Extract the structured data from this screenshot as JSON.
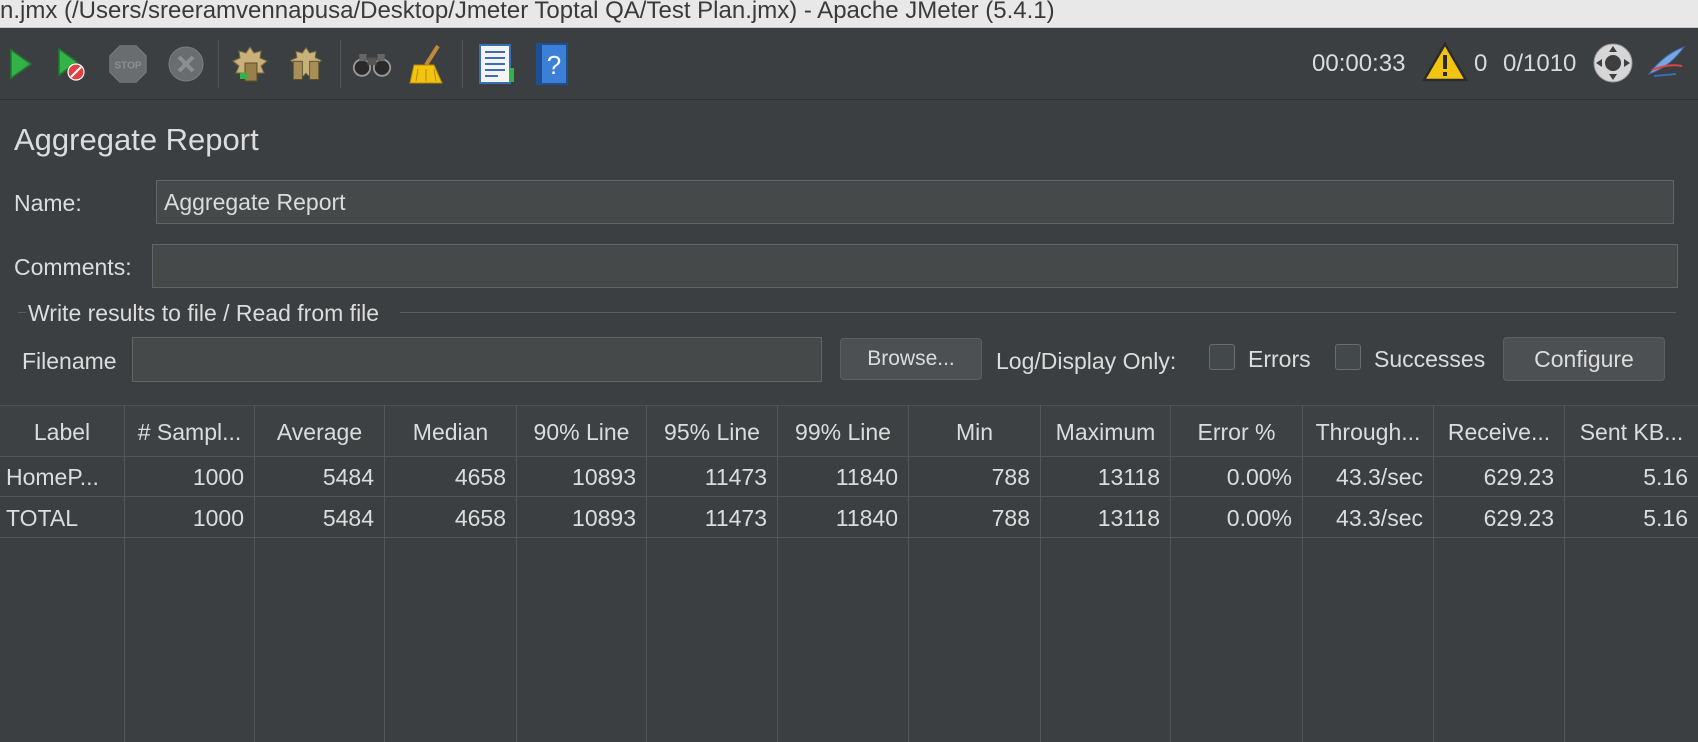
{
  "window": {
    "title": "n.jmx (/Users/sreeramvennapusa/Desktop/Jmeter Toptal QA/Test Plan.jmx) - Apache JMeter (5.4.1)"
  },
  "toolbar": {
    "icons": [
      "start-icon",
      "start-no-pauses-icon",
      "stop-icon",
      "shutdown-icon",
      "clear-icon",
      "clear-all-icon",
      "search-icon",
      "reset-search-icon",
      "function-helper-icon",
      "help-icon"
    ]
  },
  "status": {
    "elapsed": "00:00:33",
    "warnings": "0",
    "threads": "0/1010"
  },
  "panel": {
    "title": "Aggregate Report",
    "name_label": "Name:",
    "name_value": "Aggregate Report",
    "comments_label": "Comments:",
    "comments_value": "",
    "file_group_title": "Write results to file / Read from file",
    "filename_label": "Filename",
    "filename_value": "",
    "browse_label": "Browse...",
    "log_display_label": "Log/Display Only:",
    "errors_label": "Errors",
    "errors_checked": false,
    "successes_label": "Successes",
    "successes_checked": false,
    "configure_label": "Configure"
  },
  "table": {
    "columns": [
      "Label",
      "# Sampl...",
      "Average",
      "Median",
      "90% Line",
      "95% Line",
      "99% Line",
      "Min",
      "Maximum",
      "Error %",
      "Through...",
      "Receive...",
      "Sent KB..."
    ],
    "rows": [
      [
        "HomeP...",
        "1000",
        "5484",
        "4658",
        "10893",
        "11473",
        "11840",
        "788",
        "13118",
        "0.00%",
        "43.3/sec",
        "629.23",
        "5.16"
      ],
      [
        "TOTAL",
        "1000",
        "5484",
        "4658",
        "10893",
        "11473",
        "11840",
        "788",
        "13118",
        "0.00%",
        "43.3/sec",
        "629.23",
        "5.16"
      ]
    ]
  },
  "colors": {
    "background": "#3c3f41",
    "field_background": "#45494a",
    "start_green": "#34b24a",
    "warning_yellow": "#f2c40f",
    "help_blue": "#3b7fd6"
  }
}
